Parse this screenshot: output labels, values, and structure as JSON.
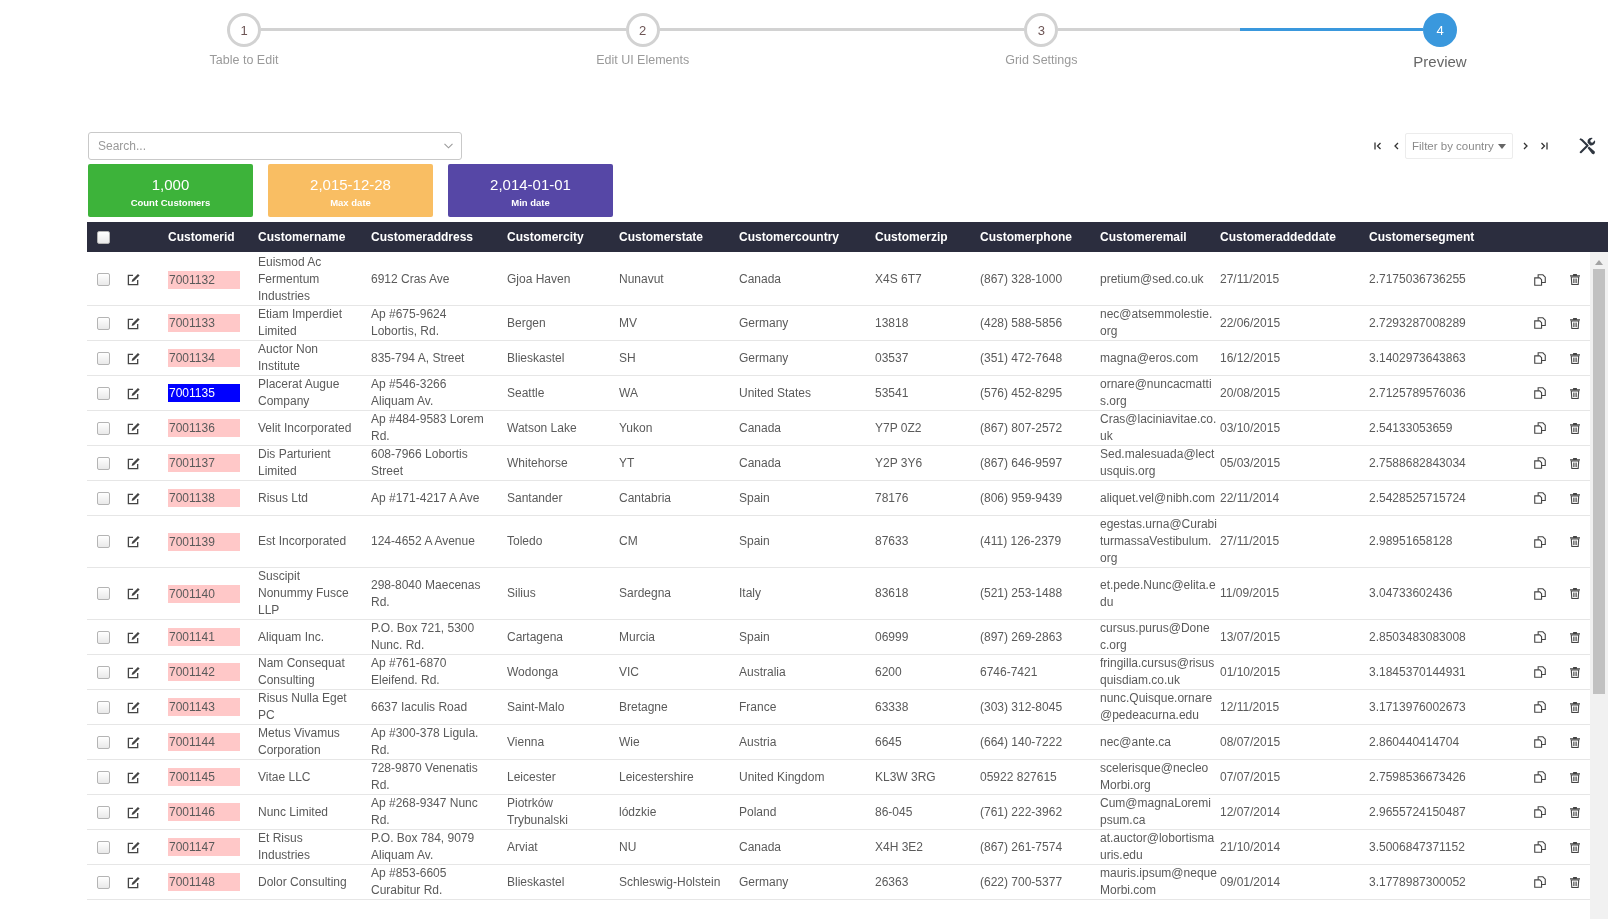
{
  "steps": [
    {
      "number": "1",
      "label": "Table to Edit",
      "selected": false
    },
    {
      "number": "2",
      "label": "Edit UI Elements",
      "selected": false
    },
    {
      "number": "3",
      "label": "Grid Settings",
      "selected": false
    },
    {
      "number": "4",
      "label": "Preview",
      "selected": true
    }
  ],
  "search": {
    "placeholder": "Search..."
  },
  "filter": {
    "label": "Filter by country"
  },
  "summary_cards": [
    {
      "value": "1,000",
      "label": "Count Customers",
      "color": "#3db33a"
    },
    {
      "value": "2,015-12-28",
      "label": "Max date",
      "color": "#f9be63"
    },
    {
      "value": "2,014-01-01",
      "label": "Min date",
      "color": "#5647a6"
    }
  ],
  "table": {
    "select_all_checked": false,
    "columns": [
      "Customerid",
      "Customername",
      "Customeraddress",
      "Customercity",
      "Customerstate",
      "Customercountry",
      "Customerzip",
      "Customerphone",
      "Customeremail",
      "Customeraddeddate",
      "Customersegment"
    ],
    "rows": [
      {
        "checked": false,
        "selected": false,
        "cells": [
          "7001132",
          "Euismod Ac Fermentum Industries",
          "6912 Cras Ave",
          "Gjoa Haven",
          "Nunavut",
          "Canada",
          "X4S 6T7",
          "(867) 328-1000",
          "pretium@sed.co.uk",
          "27/11/2015",
          "2.7175036736255"
        ]
      },
      {
        "checked": false,
        "selected": false,
        "cells": [
          "7001133",
          "Etiam Imperdiet Limited",
          "Ap #675-9624 Lobortis, Rd.",
          "Bergen",
          "MV",
          "Germany",
          "13818",
          "(428) 588-5856",
          "nec@atsemmolestie.org",
          "22/06/2015",
          "2.7293287008289"
        ]
      },
      {
        "checked": false,
        "selected": false,
        "cells": [
          "7001134",
          "Auctor Non Institute",
          "835-794 A, Street",
          "Blieskastel",
          "SH",
          "Germany",
          "03537",
          "(351) 472-7648",
          "magna@eros.com",
          "16/12/2015",
          "3.1402973643863"
        ]
      },
      {
        "checked": false,
        "selected": true,
        "cells": [
          "7001135",
          "Placerat Augue Company",
          "Ap #546-3266 Aliquam Av.",
          "Seattle",
          "WA",
          "United States",
          "53541",
          "(576) 452-8295",
          "ornare@nuncacmattis.org",
          "20/08/2015",
          "2.7125789576036"
        ]
      },
      {
        "checked": false,
        "selected": false,
        "cells": [
          "7001136",
          "Velit Incorporated",
          "Ap #484-9583 Lorem Rd.",
          "Watson Lake",
          "Yukon",
          "Canada",
          "Y7P 0Z2",
          "(867) 807-2572",
          "Cras@laciniavitae.co.uk",
          "03/10/2015",
          "2.54133053659"
        ]
      },
      {
        "checked": false,
        "selected": false,
        "cells": [
          "7001137",
          "Dis Parturient Limited",
          "608-7966 Lobortis Street",
          "Whitehorse",
          "YT",
          "Canada",
          "Y2P 3Y6",
          "(867) 646-9597",
          "Sed.malesuada@lectusquis.org",
          "05/03/2015",
          "2.7588682843034"
        ]
      },
      {
        "checked": false,
        "selected": false,
        "cells": [
          "7001138",
          "Risus Ltd",
          "Ap #171-4217 A Ave",
          "Santander",
          "Cantabria",
          "Spain",
          "78176",
          "(806) 959-9439",
          "aliquet.vel@nibh.com",
          "22/11/2014",
          "2.5428525715724"
        ]
      },
      {
        "checked": false,
        "selected": false,
        "cells": [
          "7001139",
          "Est Incorporated",
          "124-4652 A Avenue",
          "Toledo",
          "CM",
          "Spain",
          "87633",
          "(411) 126-2379",
          "egestas.urna@CurabiturmassaVestibulum.org",
          "27/11/2015",
          "2.98951658128"
        ]
      },
      {
        "checked": false,
        "selected": false,
        "cells": [
          "7001140",
          "Suscipit Nonummy Fusce LLP",
          "298-8040 Maecenas Rd.",
          "Silius",
          "Sardegna",
          "Italy",
          "83618",
          "(521) 253-1488",
          "et.pede.Nunc@elita.edu",
          "11/09/2015",
          "3.04733602436"
        ]
      },
      {
        "checked": false,
        "selected": false,
        "cells": [
          "7001141",
          "Aliquam Inc.",
          "P.O. Box 721, 5300 Nunc. Rd.",
          "Cartagena",
          "Murcia",
          "Spain",
          "06999",
          "(897) 269-2863",
          "cursus.purus@Donec.org",
          "13/07/2015",
          "2.8503483083008"
        ]
      },
      {
        "checked": false,
        "selected": false,
        "cells": [
          "7001142",
          "Nam Consequat Consulting",
          "Ap #761-6870 Eleifend. Rd.",
          "Wodonga",
          "VIC",
          "Australia",
          "6200",
          "6746-7421",
          "fringilla.cursus@risusquisdiam.co.uk",
          "01/10/2015",
          "3.1845370144931"
        ]
      },
      {
        "checked": false,
        "selected": false,
        "cells": [
          "7001143",
          "Risus Nulla Eget PC",
          "6637 Iaculis Road",
          "Saint-Malo",
          "Bretagne",
          "France",
          "63338",
          "(303) 312-8045",
          "nunc.Quisque.ornare@pedeacurna.edu",
          "12/11/2015",
          "3.1713976002673"
        ]
      },
      {
        "checked": false,
        "selected": false,
        "cells": [
          "7001144",
          "Metus Vivamus Corporation",
          "Ap #300-378 Ligula. Rd.",
          "Vienna",
          "Wie",
          "Austria",
          "6645",
          "(664) 140-7222",
          "nec@ante.ca",
          "08/07/2015",
          "2.860440414704"
        ]
      },
      {
        "checked": false,
        "selected": false,
        "cells": [
          "7001145",
          "Vitae LLC",
          "728-9870 Venenatis Rd.",
          "Leicester",
          "Leicestershire",
          "United Kingdom",
          "KL3W 3RG",
          "05922 827615",
          "scelerisque@necleoMorbi.org",
          "07/07/2015",
          "2.7598536673426"
        ]
      },
      {
        "checked": false,
        "selected": false,
        "cells": [
          "7001146",
          "Nunc Limited",
          "Ap #268-9347 Nunc Rd.",
          "Piotrków Trybunalski",
          "lódzkie",
          "Poland",
          "86-045",
          "(761) 222-3962",
          "Cum@magnaLoremipsum.ca",
          "12/07/2014",
          "2.9655724150487"
        ]
      },
      {
        "checked": false,
        "selected": false,
        "cells": [
          "7001147",
          "Et Risus Industries",
          "P.O. Box 784, 9079 Aliquam Av.",
          "Arviat",
          "NU",
          "Canada",
          "X4H 3E2",
          "(867) 261-7574",
          "at.auctor@lobortismauris.edu",
          "21/10/2014",
          "3.5006847371152"
        ]
      },
      {
        "checked": false,
        "selected": false,
        "cells": [
          "7001148",
          "Dolor Consulting",
          "Ap #853-6605 Curabitur Rd.",
          "Blieskastel",
          "Schleswig-Holstein",
          "Germany",
          "26363",
          "(622) 700-5377",
          "mauris.ipsum@nequeMorbi.com",
          "09/01/2014",
          "3.1778987300052"
        ]
      }
    ]
  }
}
